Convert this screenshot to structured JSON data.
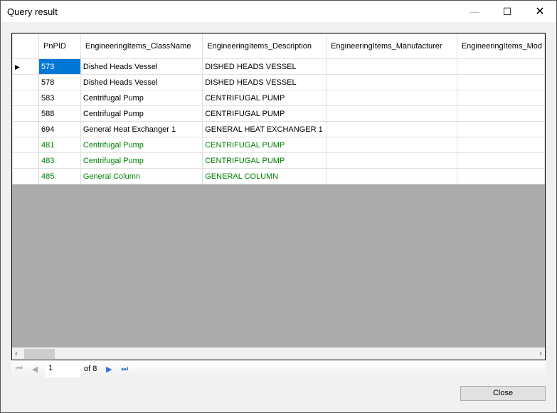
{
  "window": {
    "title": "Query result"
  },
  "grid": {
    "columns": [
      "",
      "PnPID",
      "EngineeringItems_ClassName",
      "EngineeringItems_Description",
      "EngineeringItems_Manufacturer",
      "EngineeringItems_Mod"
    ],
    "rows": [
      {
        "pnpid": "573",
        "classname": "Dished Heads Vessel",
        "description": "DISHED HEADS VESSEL",
        "manufacturer": "",
        "mod": "",
        "current": true,
        "color": "#000000"
      },
      {
        "pnpid": "578",
        "classname": "Dished Heads Vessel",
        "description": "DISHED HEADS VESSEL",
        "manufacturer": "",
        "mod": "",
        "color": "#000000"
      },
      {
        "pnpid": "583",
        "classname": "Centrifugal Pump",
        "description": "CENTRIFUGAL PUMP",
        "manufacturer": "",
        "mod": "",
        "color": "#000000"
      },
      {
        "pnpid": "588",
        "classname": "Centrifugal Pump",
        "description": "CENTRIFUGAL PUMP",
        "manufacturer": "",
        "mod": "",
        "color": "#000000"
      },
      {
        "pnpid": "694",
        "classname": "General Heat Exchanger 1",
        "description": "GENERAL HEAT EXCHANGER 1",
        "manufacturer": "",
        "mod": "",
        "color": "#000000"
      },
      {
        "pnpid": "481",
        "classname": "Centrifugal Pump",
        "description": "CENTRIFUGAL PUMP",
        "manufacturer": "",
        "mod": "",
        "color": "#008000"
      },
      {
        "pnpid": "483",
        "classname": "Centrifugal Pump",
        "description": "CENTRIFUGAL PUMP",
        "manufacturer": "",
        "mod": "",
        "color": "#008000"
      },
      {
        "pnpid": "485",
        "classname": "General Column",
        "description": "GENERAL COLUMN",
        "manufacturer": "",
        "mod": "",
        "color": "#008000"
      }
    ]
  },
  "navigator": {
    "page": "1",
    "of_label": "of 8"
  },
  "close_label": "Close",
  "selection_color": "#0078d7"
}
